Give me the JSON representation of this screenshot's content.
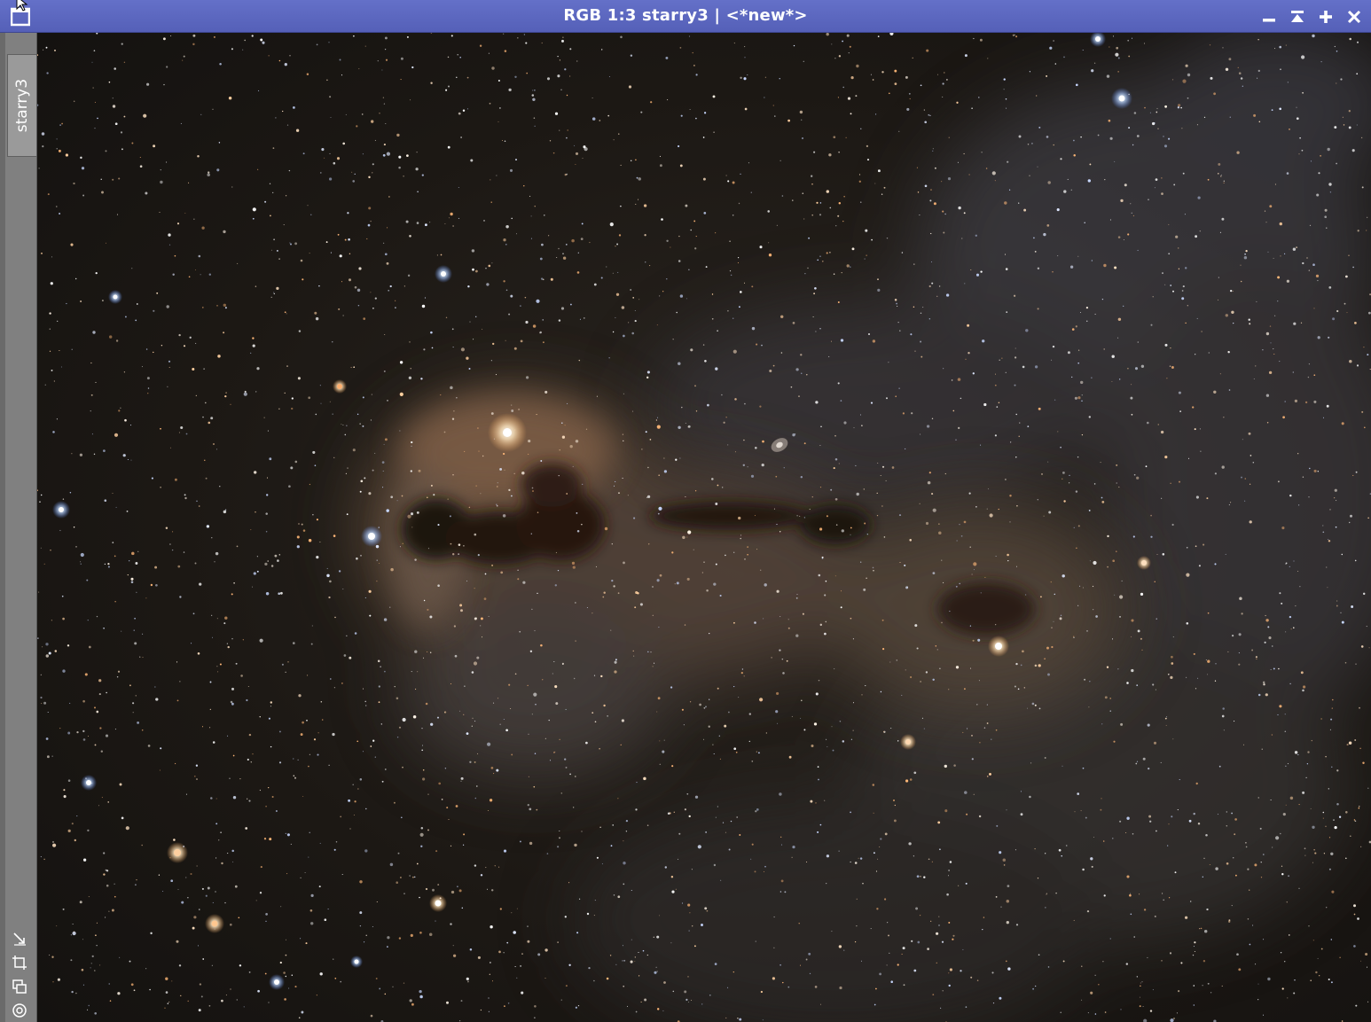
{
  "window": {
    "title": "RGB 1:3 starry3 | <*new*>",
    "buttons": [
      "minimize",
      "shade",
      "maximize",
      "close"
    ]
  },
  "view_tab": {
    "label": "starry3"
  },
  "side_tools": [
    "fit-view-icon",
    "crop-frame-icon",
    "clone-icon",
    "target-icon"
  ],
  "image": {
    "description_color": "#17140f",
    "colors": {
      "title_bar": "#5a66bd",
      "sidebar": "#808080",
      "nebula_dust": "#6b5240",
      "dark_core": "#1e120b"
    }
  }
}
